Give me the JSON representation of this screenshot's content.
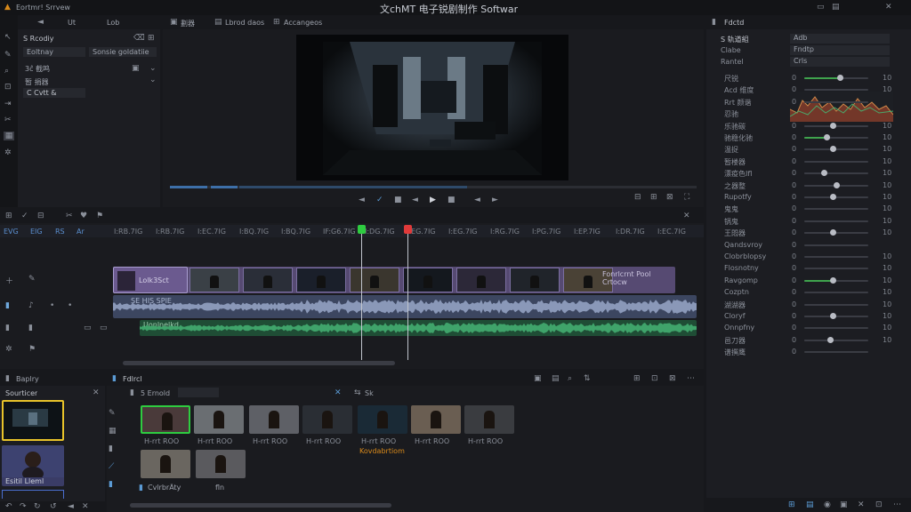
{
  "app": {
    "title": "文chMT 电子锐剧制作 Softwar",
    "project_label": "Eortmr! Srrvew"
  },
  "left_panel": {
    "tabs": [
      "Ut",
      "Lob"
    ],
    "items": [
      "S Rcodiy",
      "Eoltnay",
      "Sonsie goldatiie",
      "3ĉ 截鸣",
      "暂 捐器",
      "C Cvtt &"
    ]
  },
  "viewer": {
    "tabs": [
      "劃器",
      "Lbrod daos",
      "Accangeos"
    ],
    "transport": [
      "◄",
      "✓",
      "■",
      "◄",
      "▶",
      "■",
      "◄",
      "►"
    ]
  },
  "timeline": {
    "toolbar_icons": [
      "grid-icon",
      "check-icon",
      "link-icon",
      "cut-icon",
      "heart-icon",
      "flag-icon"
    ],
    "timecode_row": [
      "EVG",
      "EIG",
      "RS",
      "Ar"
    ],
    "ruler_ticks": [
      "I:RB.7IG",
      "I:RB.7IG",
      "I:EC.7IG",
      "I:BQ.7IG",
      "I:BQ.7IG",
      "IF:G6.7IG",
      "I:DG.7IG",
      "I:EG.7IG",
      "I:EG.7IG",
      "I:RG.7IG",
      "I:PG.7IG",
      "I:EP.7IG",
      "I:DR.7IG",
      "I:EC.7IG"
    ],
    "clip_label": "Lolk3Sct",
    "clip_end_label": "Fonrlcrnt Pool Crtocw",
    "audio_label_1": "SE HIS SPIE",
    "audio_label_2": "Uonlnelkd"
  },
  "bins": {
    "tab": "Baplry",
    "title": "Sourticer",
    "clip_2_label": "Esitil Lleml"
  },
  "media": {
    "tab": "Fdlrcl",
    "filter": "5 Ernold",
    "tag": "Sk",
    "footer": "CvlrbrÄty",
    "thumb_labels": [
      "H-rrt ROO",
      "H-rrt ROO",
      "H-rrt ROO",
      "H-rrt ROO",
      "H-rrt ROO",
      "H-rrt ROO",
      "H-rrt ROO",
      "H-rrt ROO"
    ],
    "thumb_label_orange": "Kovdabrtiom",
    "thumb_label_bottom": "fln"
  },
  "inspector": {
    "tab": "Fdctd",
    "fields": [
      {
        "label": "S 轨道組",
        "value": "Adb"
      },
      {
        "label": "Clabe",
        "value": "Fndtp"
      },
      {
        "label": "Rantel",
        "value": "Crls"
      }
    ],
    "params": [
      {
        "label": "尺锐",
        "left": "0",
        "right": "10",
        "value": 0.55,
        "color": "#3fa34d"
      },
      {
        "label": "Acd 维度",
        "left": "0",
        "right": "10",
        "value": 0.0,
        "color": "#3fa34d"
      },
      {
        "label": "Rrt 颜谐",
        "left": "0",
        "right": "",
        "value": 0.0,
        "color": "#3fa34d"
      },
      {
        "label": "忍驰",
        "left": "",
        "right": "",
        "value": 0.0,
        "color": "#3fa34d"
      },
      {
        "label": "乐驰碳",
        "left": "0",
        "right": "10",
        "value": 0.45,
        "color": "#3a3c44"
      },
      {
        "label": "驰稳化驰",
        "left": "0",
        "right": "10",
        "value": 0.35,
        "color": "#3fa34d"
      },
      {
        "label": "温捉",
        "left": "0",
        "right": "10",
        "value": 0.45,
        "color": "#3a3c44"
      },
      {
        "label": "暂楼器",
        "left": "0",
        "right": "10",
        "value": 0.0,
        "color": "#3a3c44"
      },
      {
        "label": "漂疫色Ifl",
        "left": "0",
        "right": "10",
        "value": 0.3,
        "color": "#3a3c44"
      },
      {
        "label": "之器整",
        "left": "0",
        "right": "10",
        "value": 0.5,
        "color": "#3a3c44"
      },
      {
        "label": "Rupotfy",
        "left": "0",
        "right": "10",
        "value": 0.45,
        "color": "#3a3c44"
      },
      {
        "label": "鬼鬼",
        "left": "0",
        "right": "10",
        "value": 0.0,
        "color": "#3a3c44"
      },
      {
        "label": "锅鬼",
        "left": "0",
        "right": "10",
        "value": 0.0,
        "color": "#3a3c44"
      },
      {
        "label": "王悶器",
        "left": "0",
        "right": "10",
        "value": 0.45,
        "color": "#3a3c44"
      },
      {
        "label": "Qandsvroy",
        "left": "0",
        "right": "",
        "value": 0.0,
        "color": "#3a3c44"
      },
      {
        "label": "Clobrblopsy",
        "left": "0",
        "right": "10",
        "value": 0.0,
        "color": "#3a3c44"
      },
      {
        "label": "Flosnotny",
        "left": "0",
        "right": "10",
        "value": 0.0,
        "color": "#3a3c44"
      },
      {
        "label": "Ravgomp",
        "left": "0",
        "right": "10",
        "value": 0.45,
        "color": "#3fa34d"
      },
      {
        "label": "Cozptn",
        "left": "0",
        "right": "10",
        "value": 0.0,
        "color": "#3a3c44"
      },
      {
        "label": "湖湖器",
        "left": "0",
        "right": "10",
        "value": 0.0,
        "color": "#3a3c44"
      },
      {
        "label": "Cloryf",
        "left": "0",
        "right": "10",
        "value": 0.45,
        "color": "#3a3c44"
      },
      {
        "label": "Onnpfny",
        "left": "0",
        "right": "10",
        "value": 0.0,
        "color": "#3a3c44"
      },
      {
        "label": "邑刀器",
        "left": "0",
        "right": "10",
        "value": 0.4,
        "color": "#3a3c44"
      },
      {
        "label": "谱撰鹰",
        "left": "0",
        "right": "",
        "value": 0.0,
        "color": "#3a3c44"
      }
    ]
  },
  "colors": {
    "accent_purple": "#6b5a8f",
    "accent_green": "#3fa34d",
    "playhead_green": "#2ecc40",
    "playhead_red": "#e03a3a",
    "highlight_yellow": "#e8c32a"
  }
}
